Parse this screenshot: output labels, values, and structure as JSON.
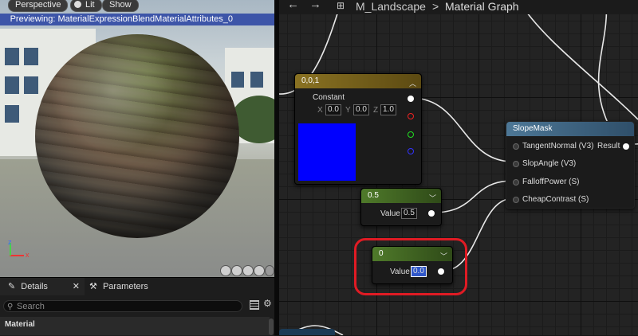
{
  "viewport": {
    "perspective_label": "Perspective",
    "lit_label": "Lit",
    "show_label": "Show",
    "preview_text": "Previewing: MaterialExpressionBlendMaterialAttributes_0"
  },
  "details_panel": {
    "tabs": [
      {
        "label": "Details"
      },
      {
        "label": "Parameters"
      }
    ],
    "search_placeholder": "Search",
    "section_label": "Material"
  },
  "graph": {
    "breadcrumb": {
      "asset": "M_Landscape",
      "separator": ">",
      "current": "Material Graph"
    },
    "constant3_node": {
      "title": "0,0,1",
      "label": "Constant",
      "x_label": "X",
      "x_value": "0.0",
      "y_label": "Y",
      "y_value": "0.0",
      "z_label": "Z",
      "z_value": "1.0",
      "preview_color": "#0000ff"
    },
    "slopemask_node": {
      "title": "SlopeMask",
      "inputs": [
        "TangentNormal (V3)",
        "SlopAngle (V3)",
        "FalloffPower (S)",
        "CheapContrast (S)"
      ],
      "output": "Result"
    },
    "scalar_node_1": {
      "title": "0.5",
      "label": "Value",
      "value": "0.5"
    },
    "scalar_node_2": {
      "title": "0",
      "label": "Value",
      "value": "0.0"
    }
  },
  "colors": {
    "preview_bar": "#3d55a8",
    "constant_header": "#8a7222",
    "scalar_header": "#4f7a2a",
    "function_header": "#4d7796",
    "highlight": "#e01b24",
    "selected_field": "#2f56c9"
  }
}
